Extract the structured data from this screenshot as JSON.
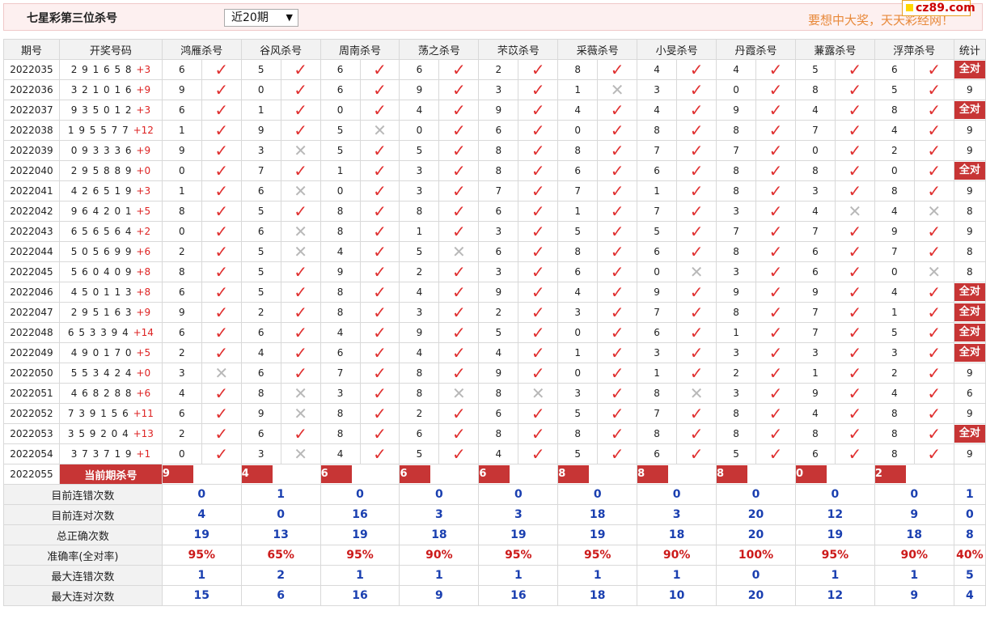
{
  "header": {
    "title": "七星彩第三位杀号",
    "select_value": "近20期",
    "slogan": "要想中大奖，天天彩经网！",
    "logo": "cz89.com"
  },
  "columns": [
    "期号",
    "开奖号码",
    "鸿雁杀号",
    "谷风杀号",
    "周南杀号",
    "荡之杀号",
    "芣苡杀号",
    "采薇杀号",
    "小旻杀号",
    "丹霞杀号",
    "蒹露杀号",
    "浮萍杀号",
    "统计"
  ],
  "rows": [
    {
      "p": "2022035",
      "d": "2 9 1 6 5 8 ",
      "s": "+3",
      "k": [
        [
          "6",
          1
        ],
        [
          "5",
          1
        ],
        [
          "6",
          1
        ],
        [
          "6",
          1
        ],
        [
          "2",
          1
        ],
        [
          "8",
          1
        ],
        [
          "4",
          1
        ],
        [
          "4",
          1
        ],
        [
          "5",
          1
        ],
        [
          "6",
          1
        ]
      ],
      "st": "全对"
    },
    {
      "p": "2022036",
      "d": "3 2 1 0 1 6 ",
      "s": "+9",
      "k": [
        [
          "9",
          1
        ],
        [
          "0",
          1
        ],
        [
          "6",
          1
        ],
        [
          "9",
          1
        ],
        [
          "3",
          1
        ],
        [
          "1",
          0
        ],
        [
          "3",
          1
        ],
        [
          "0",
          1
        ],
        [
          "8",
          1
        ],
        [
          "5",
          1
        ]
      ],
      "st": "9"
    },
    {
      "p": "2022037",
      "d": "9 3 5 0 1 2 ",
      "s": "+3",
      "k": [
        [
          "6",
          1
        ],
        [
          "1",
          1
        ],
        [
          "0",
          1
        ],
        [
          "4",
          1
        ],
        [
          "9",
          1
        ],
        [
          "4",
          1
        ],
        [
          "4",
          1
        ],
        [
          "9",
          1
        ],
        [
          "4",
          1
        ],
        [
          "8",
          1
        ]
      ],
      "st": "全对"
    },
    {
      "p": "2022038",
      "d": "1 9 5 5 7 7 ",
      "s": "+12",
      "k": [
        [
          "1",
          1
        ],
        [
          "9",
          1
        ],
        [
          "5",
          0
        ],
        [
          "0",
          1
        ],
        [
          "6",
          1
        ],
        [
          "0",
          1
        ],
        [
          "8",
          1
        ],
        [
          "8",
          1
        ],
        [
          "7",
          1
        ],
        [
          "4",
          1
        ]
      ],
      "st": "9"
    },
    {
      "p": "2022039",
      "d": "0 9 3 3 3 6 ",
      "s": "+9",
      "k": [
        [
          "9",
          1
        ],
        [
          "3",
          0
        ],
        [
          "5",
          1
        ],
        [
          "5",
          1
        ],
        [
          "8",
          1
        ],
        [
          "8",
          1
        ],
        [
          "7",
          1
        ],
        [
          "7",
          1
        ],
        [
          "0",
          1
        ],
        [
          "2",
          1
        ]
      ],
      "st": "9"
    },
    {
      "p": "2022040",
      "d": "2 9 5 8 8 9 ",
      "s": "+0",
      "k": [
        [
          "0",
          1
        ],
        [
          "7",
          1
        ],
        [
          "1",
          1
        ],
        [
          "3",
          1
        ],
        [
          "8",
          1
        ],
        [
          "6",
          1
        ],
        [
          "6",
          1
        ],
        [
          "8",
          1
        ],
        [
          "8",
          1
        ],
        [
          "0",
          1
        ]
      ],
      "st": "全对"
    },
    {
      "p": "2022041",
      "d": "4 2 6 5 1 9 ",
      "s": "+3",
      "k": [
        [
          "1",
          1
        ],
        [
          "6",
          0
        ],
        [
          "0",
          1
        ],
        [
          "3",
          1
        ],
        [
          "7",
          1
        ],
        [
          "7",
          1
        ],
        [
          "1",
          1
        ],
        [
          "8",
          1
        ],
        [
          "3",
          1
        ],
        [
          "8",
          1
        ]
      ],
      "st": "9"
    },
    {
      "p": "2022042",
      "d": "9 6 4 2 0 1 ",
      "s": "+5",
      "k": [
        [
          "8",
          1
        ],
        [
          "5",
          1
        ],
        [
          "8",
          1
        ],
        [
          "8",
          1
        ],
        [
          "6",
          1
        ],
        [
          "1",
          1
        ],
        [
          "7",
          1
        ],
        [
          "3",
          1
        ],
        [
          "4",
          0
        ],
        [
          "4",
          0
        ]
      ],
      "st": "8"
    },
    {
      "p": "2022043",
      "d": "6 5 6 5 6 4 ",
      "s": "+2",
      "k": [
        [
          "0",
          1
        ],
        [
          "6",
          0
        ],
        [
          "8",
          1
        ],
        [
          "1",
          1
        ],
        [
          "3",
          1
        ],
        [
          "5",
          1
        ],
        [
          "5",
          1
        ],
        [
          "7",
          1
        ],
        [
          "7",
          1
        ],
        [
          "9",
          1
        ]
      ],
      "st": "9"
    },
    {
      "p": "2022044",
      "d": "5 0 5 6 9 9 ",
      "s": "+6",
      "k": [
        [
          "2",
          1
        ],
        [
          "5",
          0
        ],
        [
          "4",
          1
        ],
        [
          "5",
          0
        ],
        [
          "6",
          1
        ],
        [
          "8",
          1
        ],
        [
          "6",
          1
        ],
        [
          "8",
          1
        ],
        [
          "6",
          1
        ],
        [
          "7",
          1
        ]
      ],
      "st": "8"
    },
    {
      "p": "2022045",
      "d": "5 6 0 4 0 9 ",
      "s": "+8",
      "k": [
        [
          "8",
          1
        ],
        [
          "5",
          1
        ],
        [
          "9",
          1
        ],
        [
          "2",
          1
        ],
        [
          "3",
          1
        ],
        [
          "6",
          1
        ],
        [
          "0",
          0
        ],
        [
          "3",
          1
        ],
        [
          "6",
          1
        ],
        [
          "0",
          0
        ]
      ],
      "st": "8"
    },
    {
      "p": "2022046",
      "d": "4 5 0 1 1 3 ",
      "s": "+8",
      "k": [
        [
          "6",
          1
        ],
        [
          "5",
          1
        ],
        [
          "8",
          1
        ],
        [
          "4",
          1
        ],
        [
          "9",
          1
        ],
        [
          "4",
          1
        ],
        [
          "9",
          1
        ],
        [
          "9",
          1
        ],
        [
          "9",
          1
        ],
        [
          "4",
          1
        ]
      ],
      "st": "全对"
    },
    {
      "p": "2022047",
      "d": "2 9 5 1 6 3 ",
      "s": "+9",
      "k": [
        [
          "9",
          1
        ],
        [
          "2",
          1
        ],
        [
          "8",
          1
        ],
        [
          "3",
          1
        ],
        [
          "2",
          1
        ],
        [
          "3",
          1
        ],
        [
          "7",
          1
        ],
        [
          "8",
          1
        ],
        [
          "7",
          1
        ],
        [
          "1",
          1
        ]
      ],
      "st": "全对"
    },
    {
      "p": "2022048",
      "d": "6 5 3 3 9 4 ",
      "s": "+14",
      "k": [
        [
          "6",
          1
        ],
        [
          "6",
          1
        ],
        [
          "4",
          1
        ],
        [
          "9",
          1
        ],
        [
          "5",
          1
        ],
        [
          "0",
          1
        ],
        [
          "6",
          1
        ],
        [
          "1",
          1
        ],
        [
          "7",
          1
        ],
        [
          "5",
          1
        ]
      ],
      "st": "全对"
    },
    {
      "p": "2022049",
      "d": "4 9 0 1 7 0 ",
      "s": "+5",
      "k": [
        [
          "2",
          1
        ],
        [
          "4",
          1
        ],
        [
          "6",
          1
        ],
        [
          "4",
          1
        ],
        [
          "4",
          1
        ],
        [
          "1",
          1
        ],
        [
          "3",
          1
        ],
        [
          "3",
          1
        ],
        [
          "3",
          1
        ],
        [
          "3",
          1
        ]
      ],
      "st": "全对"
    },
    {
      "p": "2022050",
      "d": "5 5 3 4 2 4 ",
      "s": "+0",
      "k": [
        [
          "3",
          0
        ],
        [
          "6",
          1
        ],
        [
          "7",
          1
        ],
        [
          "8",
          1
        ],
        [
          "9",
          1
        ],
        [
          "0",
          1
        ],
        [
          "1",
          1
        ],
        [
          "2",
          1
        ],
        [
          "1",
          1
        ],
        [
          "2",
          1
        ]
      ],
      "st": "9"
    },
    {
      "p": "2022051",
      "d": "4 6 8 2 8 8 ",
      "s": "+6",
      "k": [
        [
          "4",
          1
        ],
        [
          "8",
          0
        ],
        [
          "3",
          1
        ],
        [
          "8",
          0
        ],
        [
          "8",
          0
        ],
        [
          "3",
          1
        ],
        [
          "8",
          0
        ],
        [
          "3",
          1
        ],
        [
          "9",
          1
        ],
        [
          "4",
          1
        ]
      ],
      "st": "6"
    },
    {
      "p": "2022052",
      "d": "7 3 9 1 5 6 ",
      "s": "+11",
      "k": [
        [
          "6",
          1
        ],
        [
          "9",
          0
        ],
        [
          "8",
          1
        ],
        [
          "2",
          1
        ],
        [
          "6",
          1
        ],
        [
          "5",
          1
        ],
        [
          "7",
          1
        ],
        [
          "8",
          1
        ],
        [
          "4",
          1
        ],
        [
          "8",
          1
        ]
      ],
      "st": "9"
    },
    {
      "p": "2022053",
      "d": "3 5 9 2 0 4 ",
      "s": "+13",
      "k": [
        [
          "2",
          1
        ],
        [
          "6",
          1
        ],
        [
          "8",
          1
        ],
        [
          "6",
          1
        ],
        [
          "8",
          1
        ],
        [
          "8",
          1
        ],
        [
          "8",
          1
        ],
        [
          "8",
          1
        ],
        [
          "8",
          1
        ],
        [
          "8",
          1
        ]
      ],
      "st": "全对"
    },
    {
      "p": "2022054",
      "d": "3 7 3 7 1 9 ",
      "s": "+1",
      "k": [
        [
          "0",
          1
        ],
        [
          "3",
          0
        ],
        [
          "4",
          1
        ],
        [
          "5",
          1
        ],
        [
          "4",
          1
        ],
        [
          "5",
          1
        ],
        [
          "6",
          1
        ],
        [
          "5",
          1
        ],
        [
          "6",
          1
        ],
        [
          "8",
          1
        ]
      ],
      "st": "9"
    }
  ],
  "current": {
    "p": "2022055",
    "label": "当前期杀号",
    "k": [
      "9",
      "4",
      "6",
      "6",
      "6",
      "8",
      "8",
      "8",
      "0",
      "2"
    ]
  },
  "stats": [
    {
      "label": "目前连错次数",
      "v": [
        "0",
        "1",
        "0",
        "0",
        "0",
        "0",
        "0",
        "0",
        "0",
        "0",
        "1"
      ],
      "cls": "sval"
    },
    {
      "label": "目前连对次数",
      "v": [
        "4",
        "0",
        "16",
        "3",
        "3",
        "18",
        "3",
        "20",
        "12",
        "9",
        "0"
      ],
      "cls": "sval"
    },
    {
      "label": "总正确次数",
      "v": [
        "19",
        "13",
        "19",
        "18",
        "19",
        "19",
        "18",
        "20",
        "19",
        "18",
        "8"
      ],
      "cls": "sval"
    },
    {
      "label": "准确率(全对率)",
      "v": [
        "95%",
        "65%",
        "95%",
        "90%",
        "95%",
        "95%",
        "90%",
        "100%",
        "95%",
        "90%",
        "40%"
      ],
      "cls": "pct"
    },
    {
      "label": "最大连错次数",
      "v": [
        "1",
        "2",
        "1",
        "1",
        "1",
        "1",
        "1",
        "0",
        "1",
        "1",
        "5"
      ],
      "cls": "sval"
    },
    {
      "label": "最大连对次数",
      "v": [
        "15",
        "6",
        "16",
        "9",
        "16",
        "18",
        "10",
        "20",
        "12",
        "9",
        "4"
      ],
      "cls": "sval"
    }
  ],
  "marks": {
    "ok": "✓",
    "no": "✕"
  },
  "colors": {
    "accent_red": "#c73535",
    "stat_blue": "#1a3fb0",
    "mark_red": "#e03030",
    "mark_grey": "#b8b8b8"
  }
}
